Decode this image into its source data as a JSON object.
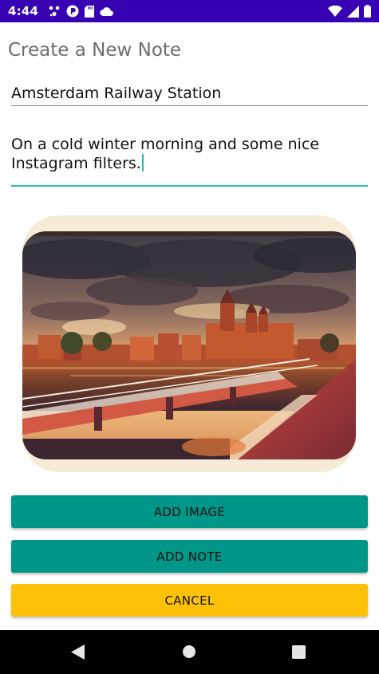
{
  "status_bar": {
    "time": "4:44",
    "notification_icons": [
      "settings-icon",
      "app-icon",
      "sd-card-icon",
      "cloud-icon"
    ],
    "system_icons": [
      "wifi-icon",
      "signal-icon",
      "battery-icon"
    ],
    "color": "#3700b3"
  },
  "page": {
    "title": "Create a New Note"
  },
  "form": {
    "note_title": "Amsterdam Railway Station",
    "note_body": "On a cold winter morning and some nice Instagram filters."
  },
  "image_preview": {
    "icon": "amsterdam-station-photo"
  },
  "buttons": {
    "add_image": "ADD IMAGE",
    "add_note": "ADD NOTE",
    "cancel": "CANCEL"
  },
  "colors": {
    "primary_button": "#009688",
    "cancel_button": "#ffc107",
    "accent": "#26bdae"
  },
  "nav_bar": {
    "icons": [
      "back-icon",
      "home-icon",
      "recents-icon"
    ]
  }
}
